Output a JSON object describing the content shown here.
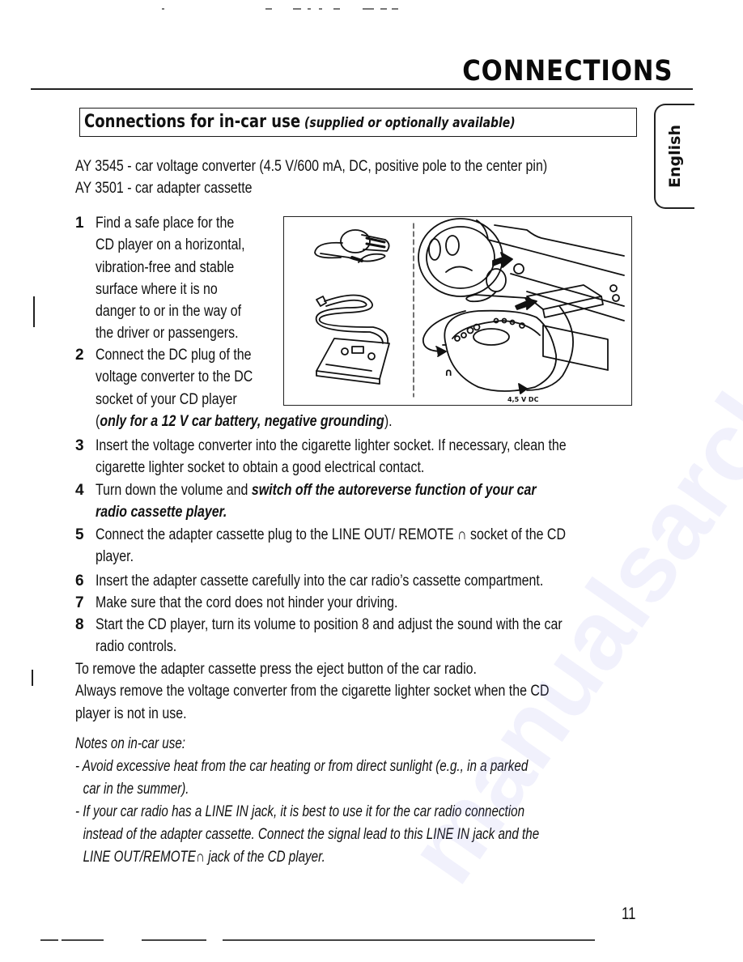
{
  "header": {
    "title": "CONNECTIONS"
  },
  "language_tab": {
    "label": "English"
  },
  "section": {
    "heading": "Connections for in-car use",
    "subheading": "(supplied or optionally available)"
  },
  "accessories": [
    "AY 3545 - car voltage converter (4.5 V/600 mA, DC, positive pole to the center pin)",
    "AY 3501 - car adapter cassette"
  ],
  "figure": {
    "dc_label": "4,5 V DC",
    "headphone_symbol": "∩",
    "description": "Car voltage converter and adapter cassette connected to CD player in car"
  },
  "steps": [
    {
      "number": "1",
      "lines": [
        [
          {
            "text": "Find a safe place for the"
          }
        ],
        [
          {
            "text": "CD player on a horizontal,"
          }
        ],
        [
          {
            "text": "vibration-free and stable"
          }
        ],
        [
          {
            "text": "surface where it is no"
          }
        ],
        [
          {
            "text": "danger to or in the way of"
          }
        ],
        [
          {
            "text": "the driver or passengers."
          }
        ]
      ]
    },
    {
      "number": "2",
      "lines": [
        [
          {
            "text": "Connect the DC plug of the"
          }
        ],
        [
          {
            "text": "voltage converter to the DC"
          }
        ],
        [
          {
            "text": "socket of your CD player"
          }
        ],
        [
          {
            "text": "(",
            "bold": false
          },
          {
            "text": "only for a 12 V car battery, negative grounding",
            "bold": true
          },
          {
            "text": ").",
            "bold": false
          }
        ]
      ]
    },
    {
      "number": "3",
      "lines": [
        [
          {
            "text": "Insert the voltage converter into the cigarette lighter socket. If necessary, clean the"
          }
        ],
        [
          {
            "text": "cigarette lighter socket to obtain a good electrical contact."
          }
        ]
      ]
    },
    {
      "number": "4",
      "lines": [
        [
          {
            "text": "Turn down the volume and "
          },
          {
            "text": "switch off the autoreverse function of your car",
            "bold": true
          }
        ],
        [
          {
            "text": "radio cassette player.",
            "bold": true
          }
        ]
      ]
    },
    {
      "number": "5",
      "lines": [
        [
          {
            "text": "Connect the adapter cassette plug to the LINE OUT/ REMOTE ∩ socket of the CD"
          }
        ],
        [
          {
            "text": "player."
          }
        ]
      ]
    },
    {
      "number": "6",
      "lines": [
        [
          {
            "text": "Insert the adapter cassette carefully into the car radio’s cassette compartment."
          }
        ]
      ]
    },
    {
      "number": "7",
      "lines": [
        [
          {
            "text": "Make sure that the cord does not hinder your driving."
          }
        ]
      ]
    },
    {
      "number": "8",
      "lines": [
        [
          {
            "text": "Start the CD player, turn its volume to position 8 and adjust the sound with the car"
          }
        ],
        [
          {
            "text": "radio controls."
          }
        ]
      ]
    }
  ],
  "removal": [
    "To remove the adapter cassette press the eject button of the car radio.",
    "Always remove the voltage converter from the cigarette lighter socket when the CD",
    "player is not in use."
  ],
  "notes": {
    "title": "Notes on in-car use:",
    "lines": [
      "- Avoid excessive heat from the car heating or from direct sunlight (e.g., in a parked",
      "  car in the summer).",
      "- If your car radio has a LINE IN jack, it is best to use it for the car radio connection",
      "  instead of the adapter cassette. Connect the signal lead to this LINE IN jack and the",
      "  LINE OUT/REMOTE∩ jack of the CD player."
    ]
  },
  "footer": {
    "page_number": "11"
  },
  "watermark": "manualsarchive.com"
}
